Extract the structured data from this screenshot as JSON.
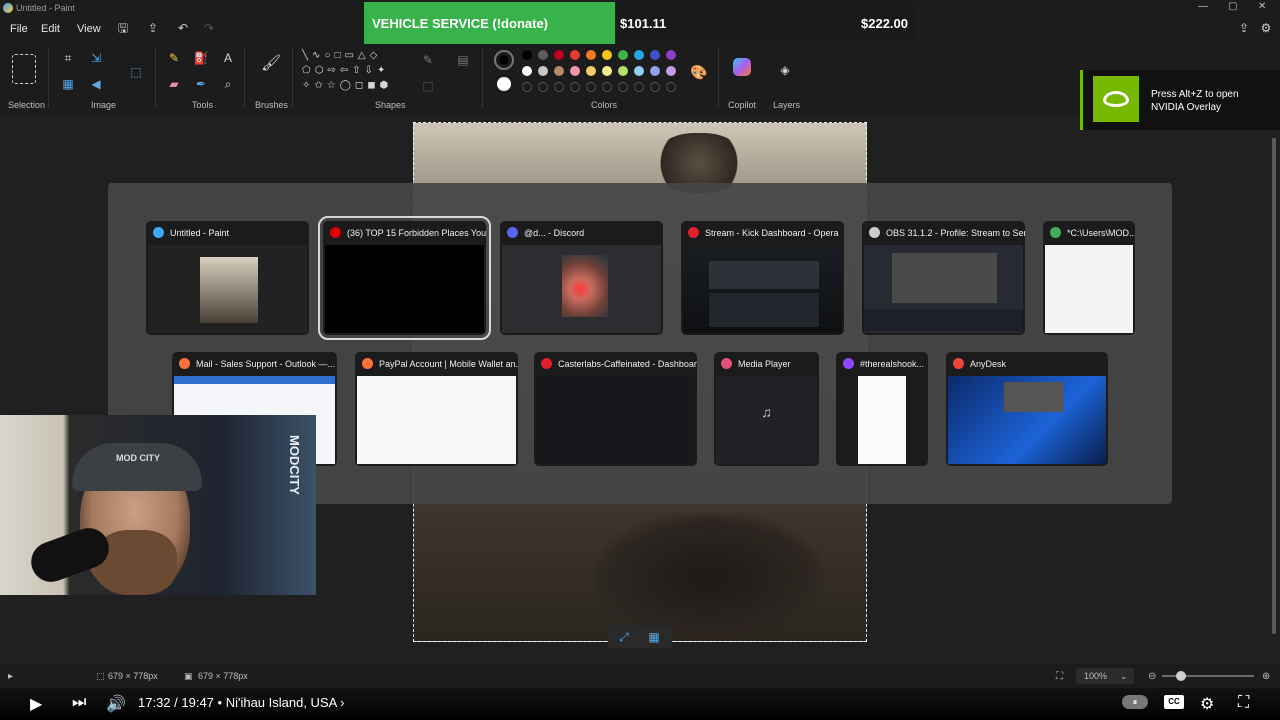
{
  "window": {
    "title": "Untitled - Paint"
  },
  "menu": {
    "file": "File",
    "edit": "Edit",
    "view": "View"
  },
  "ribbon": {
    "groups": {
      "selection": "Selection",
      "image": "Image",
      "tools": "Tools",
      "brushes": "Brushes",
      "shapes": "Shapes",
      "colors": "Colors",
      "copilot": "Copilot",
      "layers": "Layers"
    },
    "palette_row1": [
      "#000000",
      "#5d5d5d",
      "#c00020",
      "#e63b2e",
      "#f07b20",
      "#f5c518",
      "#41b14a",
      "#27a6e4",
      "#3f51c9",
      "#8e3ec8"
    ],
    "palette_row2": [
      "#ffffff",
      "#c9c9c9",
      "#b98a6a",
      "#f09aa8",
      "#f7cf6a",
      "#f4ee8a",
      "#b7e06a",
      "#8fd1f0",
      "#8fa3e8",
      "#c59be2"
    ],
    "primary_color": "#000000",
    "secondary_color": "#ffffff"
  },
  "donation": {
    "label": "VEHICLE SERVICE (!donate)",
    "current": "$101.11",
    "goal": "$222.00",
    "progress": 0.455,
    "bar_color": "#38b24a"
  },
  "nvidia": {
    "message": "Press Alt+Z to open NVIDIA Overlay",
    "brand_color": "#76b900"
  },
  "switcher": {
    "row1": [
      {
        "title": "Untitled - Paint",
        "icon": "paint-icon",
        "color": "#3da8ff"
      },
      {
        "title": "(36) TOP 15 Forbidden Places You...",
        "icon": "youtube-icon",
        "color": "#e00000",
        "selected": true
      },
      {
        "title": "@d... - Discord",
        "icon": "discord-icon",
        "color": "#5865f2"
      },
      {
        "title": "Stream - Kick Dashboard - Opera",
        "icon": "opera-icon",
        "color": "#e0202a"
      },
      {
        "title": "OBS 31.1.2 - Profile: Stream to Serv...",
        "icon": "obs-icon",
        "color": "#cccccc"
      },
      {
        "title": "*C:\\Users\\MOD...",
        "icon": "notepad-icon",
        "color": "#3fae5a"
      }
    ],
    "row2": [
      {
        "title": "Mail - Sales Support - Outlook —...",
        "icon": "firefox-icon",
        "color": "#ff7139"
      },
      {
        "title": "PayPal Account | Mobile Wallet an...",
        "icon": "firefox-icon",
        "color": "#ff7139"
      },
      {
        "title": "Casterlabs-Caffeinated - Dashboard",
        "icon": "casterlabs-icon",
        "color": "#e0202a"
      },
      {
        "title": "Media Player",
        "icon": "media-player-icon",
        "color": "#e0507a"
      },
      {
        "title": "#therealshook...",
        "icon": "twitch-icon",
        "color": "#9146ff"
      },
      {
        "title": "AnyDesk",
        "icon": "anydesk-icon",
        "color": "#ef443b"
      }
    ]
  },
  "webcam": {
    "cap_text": "MOD CITY",
    "shirt_text": "MODCITY"
  },
  "statusbar": {
    "selection_size": "679 × 778px",
    "canvas_size": "679 × 778px",
    "zoom": "100%"
  },
  "player": {
    "time": "17:32 / 19:47",
    "chapter": "• Ni'ihau Island, USA ›"
  }
}
